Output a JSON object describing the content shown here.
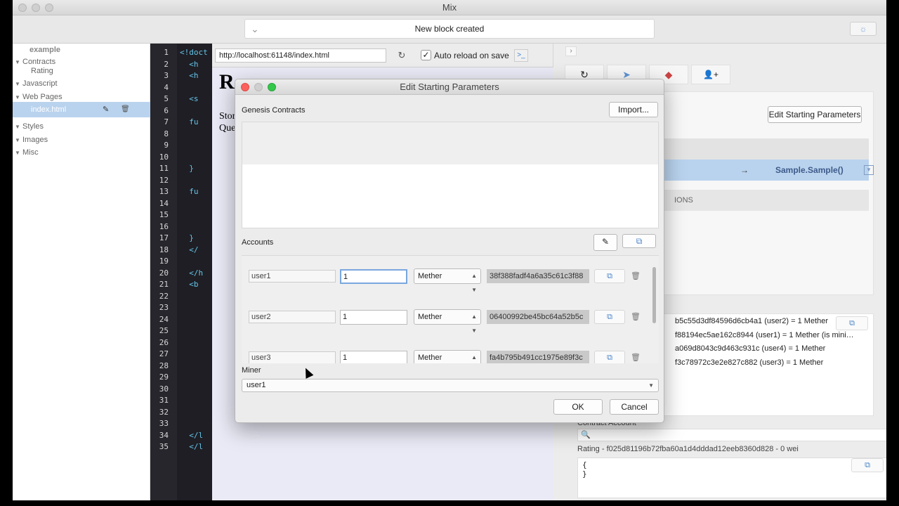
{
  "window": {
    "title": "Mix"
  },
  "toolbar": {
    "status": "New block created"
  },
  "sidebar": {
    "project": "example",
    "items": [
      {
        "label": "Contracts",
        "type": "section"
      },
      {
        "label": "Rating",
        "type": "child"
      },
      {
        "label": "Javascript",
        "type": "section"
      },
      {
        "label": "Web Pages",
        "type": "section"
      },
      {
        "label": "index.html",
        "type": "selected"
      },
      {
        "label": "Styles",
        "type": "section"
      },
      {
        "label": "Images",
        "type": "section"
      },
      {
        "label": "Misc",
        "type": "section"
      }
    ]
  },
  "editor": {
    "line_numbers": [
      "1",
      "2",
      "3",
      "4",
      "5",
      "6",
      "7",
      "8",
      "9",
      "10",
      "11",
      "12",
      "13",
      "14",
      "15",
      "16",
      "17",
      "18",
      "19",
      "20",
      "21",
      "22",
      "23",
      "24",
      "25",
      "26",
      "27",
      "28",
      "29",
      "30",
      "31",
      "32",
      "33",
      "34",
      "35"
    ],
    "lines": [
      "<!doct",
      "  <h",
      "  <h",
      "",
      "  <s",
      "",
      "  fu",
      "",
      "",
      "",
      "  }",
      "",
      "  fu",
      "",
      "",
      "",
      "  }",
      "  </",
      "",
      "  </h",
      "  <b",
      "",
      "",
      "",
      "",
      "",
      "",
      "",
      "",
      "",
      "",
      "",
      "",
      "  </l",
      "  </l"
    ]
  },
  "preview": {
    "url": "http://localhost:61148/index.html",
    "auto_reload_label": "Auto reload on save",
    "auto_reload_checked": "✓",
    "title_fragment": "R",
    "text_lines": [
      "Stor",
      "Que"
    ]
  },
  "right_panel": {
    "edit_params_button": "Edit Starting Parameters",
    "arrow": "→",
    "transaction_target": "Sample.Sample()",
    "section_fragment": "IONS",
    "log_lines": [
      "b5c55d3df84596d6cb4a1 (user2) = 1 Mether",
      "f88194ec5ae162c8944 (user1) = 1 Mether (is mini…",
      "a069d8043c9d463c931c (user4) = 1 Mether",
      "f3c78972c3e2e827c882 (user3) = 1 Mether"
    ],
    "contract_account_label": "Contract Account",
    "rating_line": "Rating - f025d81196b72fba60a1d4dddad12eeb8360d828 - 0 wei",
    "json_lines": [
      "{",
      "}"
    ]
  },
  "modal": {
    "title": "Edit Starting Parameters",
    "genesis_label": "Genesis Contracts",
    "import_button": "Import...",
    "accounts_label": "Accounts",
    "accounts": [
      {
        "name": "user1",
        "amount": "1",
        "unit": "Mether",
        "key": "38f388fadf4a6a35c61c3f88"
      },
      {
        "name": "user2",
        "amount": "1",
        "unit": "Mether",
        "key": "06400992be45bc64a52b5c"
      },
      {
        "name": "user3",
        "amount": "1",
        "unit": "Mether",
        "key": "fa4b795b491cc1975e89f3c"
      }
    ],
    "miner_label": "Miner",
    "miner_value": "user1",
    "ok_button": "OK",
    "cancel_button": "Cancel"
  },
  "icons": {
    "reload": "↻",
    "send": "➤",
    "eraser": "◆",
    "add_user": "👤+",
    "copy": "⧉",
    "trash": "🗑",
    "pencil": "✎",
    "bug": "☼",
    "chevron_down": "⌄",
    "nav_forward": "›",
    "terminal": ">_",
    "dropdown": "▼",
    "search": "🔍"
  },
  "colors": {
    "selection": "#b9d3ee",
    "close": "#fc605c",
    "minimize": "#cfcfcf",
    "zoom": "#34c84a"
  }
}
